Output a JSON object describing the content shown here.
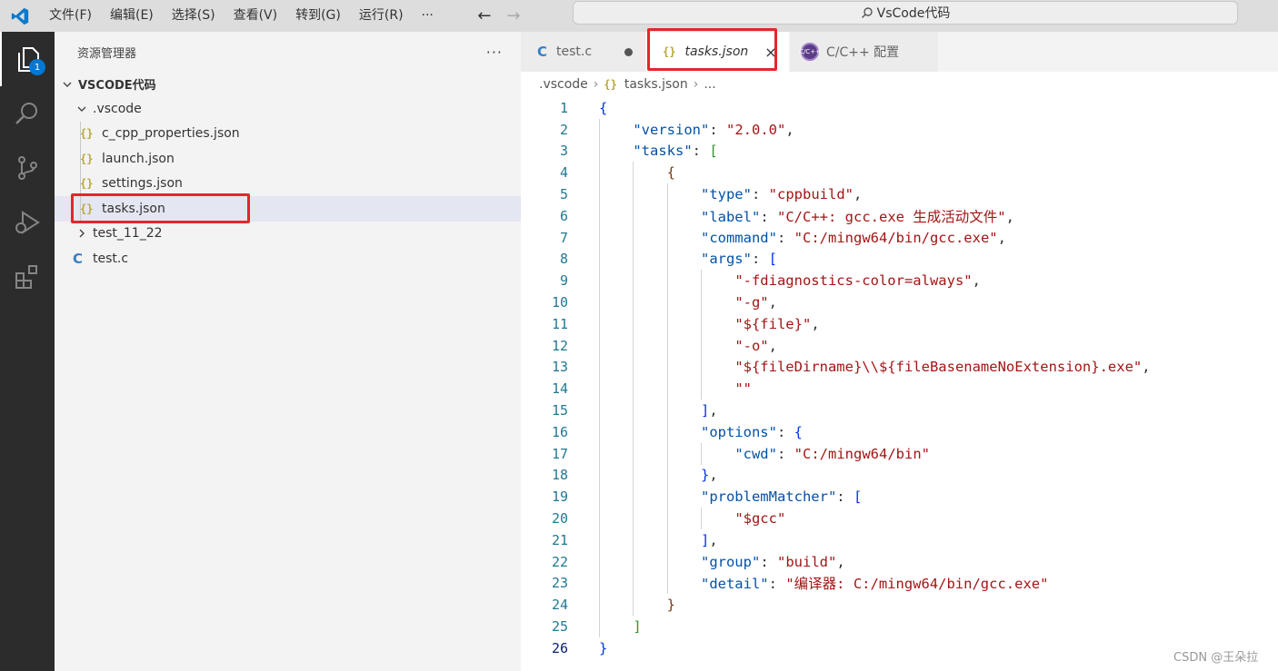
{
  "titlebar": {
    "menu": [
      "文件(F)",
      "编辑(E)",
      "选择(S)",
      "查看(V)",
      "转到(G)",
      "运行(R)",
      "···"
    ],
    "search_text": "VsCode代码"
  },
  "activitybar": {
    "items": [
      "files-icon",
      "search-icon",
      "source-control-icon",
      "run-debug-icon",
      "extensions-icon"
    ],
    "badge": "1"
  },
  "sidebar": {
    "title": "资源管理器",
    "more": "···",
    "root": "VSCODE代码",
    "tree": [
      {
        "label": ".vscode",
        "type": "folder",
        "expanded": true
      },
      {
        "label": "c_cpp_properties.json",
        "type": "json"
      },
      {
        "label": "launch.json",
        "type": "json"
      },
      {
        "label": "settings.json",
        "type": "json"
      },
      {
        "label": "tasks.json",
        "type": "json",
        "selected": true
      },
      {
        "label": "test_11_22",
        "type": "folder",
        "expanded": false
      },
      {
        "label": "test.c",
        "type": "c"
      }
    ]
  },
  "editor": {
    "tabs": [
      {
        "label": "test.c",
        "icon": "C",
        "dirty": true
      },
      {
        "label": "tasks.json",
        "icon": "{}",
        "active": true
      },
      {
        "label": "C/C++ 配置",
        "icon": "C/C++"
      }
    ],
    "breadcrumb": [
      ".vscode",
      "tasks.json",
      "..."
    ],
    "json_icon": "{}",
    "c_icon": "C",
    "close": "×"
  },
  "code_lines": [
    "{",
    "    \"version\": \"2.0.0\",",
    "    \"tasks\": [",
    "        {",
    "            \"type\": \"cppbuild\",",
    "            \"label\": \"C/C++: gcc.exe 生成活动文件\",",
    "            \"command\": \"C:/mingw64/bin/gcc.exe\",",
    "            \"args\": [",
    "                \"-fdiagnostics-color=always\",",
    "                \"-g\",",
    "                \"${file}\",",
    "                \"-o\",",
    "                \"${fileDirname}\\\\${fileBasenameNoExtension}.exe\",",
    "                \"\"",
    "            ],",
    "            \"options\": {",
    "                \"cwd\": \"C:/mingw64/bin\"",
    "            },",
    "            \"problemMatcher\": [",
    "                \"$gcc\"",
    "            ],",
    "            \"group\": \"build\",",
    "            \"detail\": \"编译器: C:/mingw64/bin/gcc.exe\"",
    "        }",
    "    ]",
    "}"
  ],
  "colors": {
    "key": "#0451a5",
    "string": "#a31515",
    "bracket1": "#0431fa",
    "bracket2": "#319331",
    "bracket3": "#7b3814",
    "highlight_box": "#e5262b"
  },
  "watermark": "CSDN @王朵拉"
}
